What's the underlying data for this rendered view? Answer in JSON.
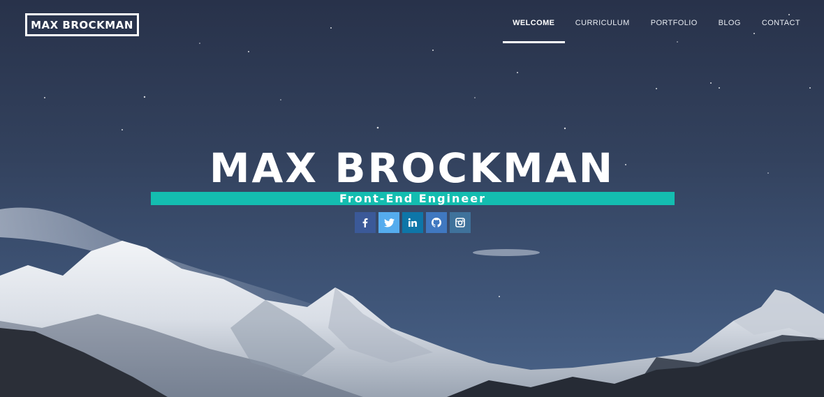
{
  "header": {
    "logo_text": "MAX BROCKMAN",
    "nav": [
      {
        "label": "WELCOME",
        "active": true
      },
      {
        "label": "CURRICULUM",
        "active": false
      },
      {
        "label": "PORTFOLIO",
        "active": false
      },
      {
        "label": "BLOG",
        "active": false
      },
      {
        "label": "CONTACT",
        "active": false
      }
    ]
  },
  "hero": {
    "title": "MAX BROCKMAN",
    "subtitle": "Front-End Engineer",
    "background": "night sky over snow-capped mountains"
  },
  "social": [
    {
      "icon": "facebook-icon",
      "color": "#3b5998"
    },
    {
      "icon": "twitter-icon",
      "color": "#55acee"
    },
    {
      "icon": "linkedin-icon",
      "color": "#0e76a8"
    },
    {
      "icon": "github-icon",
      "color": "#4078c0"
    },
    {
      "icon": "instagram-icon",
      "color": "#3f729b"
    }
  ],
  "colors": {
    "accent": "#14bdb0",
    "text": "#ffffff"
  }
}
